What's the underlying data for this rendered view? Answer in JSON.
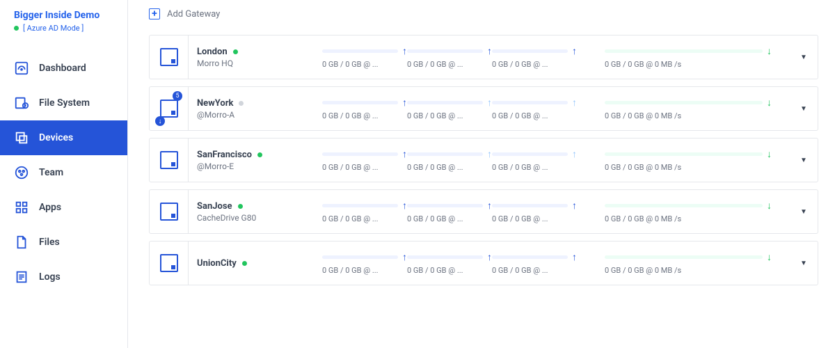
{
  "brand": {
    "title": "Bigger Inside Demo",
    "mode": "[ Azure AD Mode ]"
  },
  "nav": [
    {
      "label": "Dashboard"
    },
    {
      "label": "File System"
    },
    {
      "label": "Devices"
    },
    {
      "label": "Team"
    },
    {
      "label": "Apps"
    },
    {
      "label": "Files"
    },
    {
      "label": "Logs"
    }
  ],
  "addGateway": "Add Gateway",
  "statText": "0 GB / 0 GB @ ...",
  "statWideText": "0 GB / 0 GB @ 0 MB /s",
  "gateways": [
    {
      "name": "London",
      "sub": "Morro HQ",
      "status": "green",
      "arrows": [
        "up-blue",
        "up-blue",
        "up-blue"
      ]
    },
    {
      "name": "NewYork",
      "sub": "@Morro-A",
      "status": "grey",
      "badge": "5",
      "dl": true,
      "arrows": [
        "up-blue",
        "up-light",
        "up-light"
      ]
    },
    {
      "name": "SanFrancisco",
      "sub": "@Morro-E",
      "status": "green",
      "arrows": [
        "up-blue",
        "up-light",
        "up-light"
      ]
    },
    {
      "name": "SanJose",
      "sub": "CacheDrive G80",
      "status": "green",
      "arrows": [
        "up-blue",
        "up-blue",
        "up-blue"
      ]
    },
    {
      "name": "UnionCity",
      "sub": "",
      "status": "green",
      "arrows": [
        "up-blue",
        "up-blue",
        "up-blue"
      ]
    }
  ]
}
